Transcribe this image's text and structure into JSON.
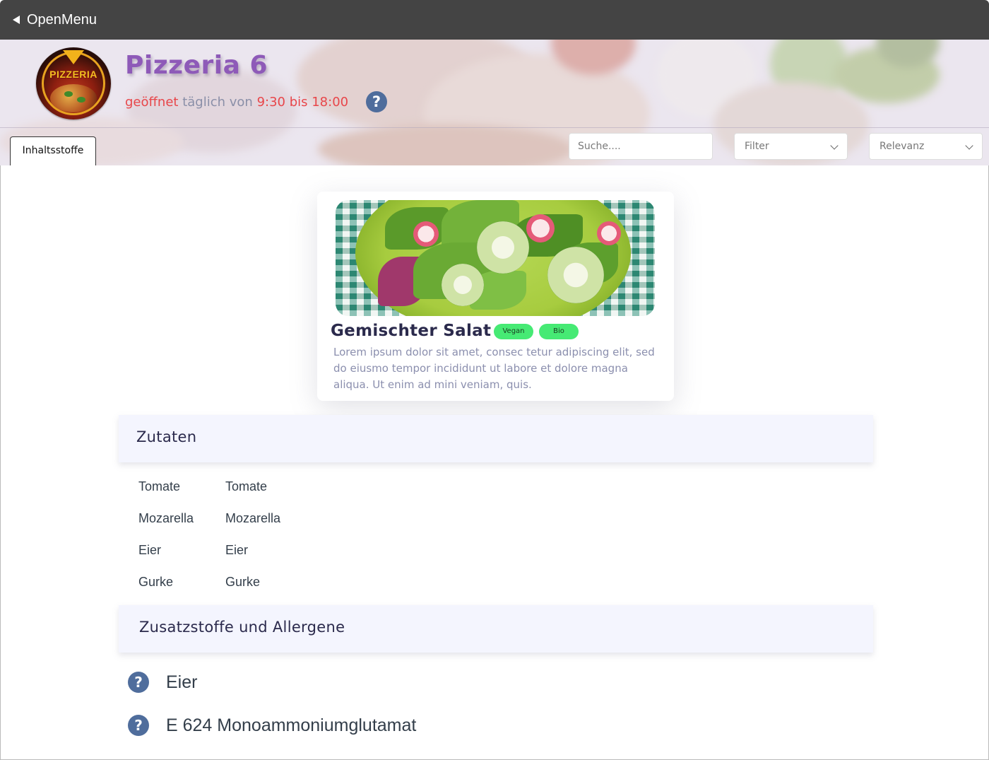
{
  "topbar": {
    "open_menu_label": "OpenMenu"
  },
  "restaurant": {
    "name": "Pizzeria 6",
    "logo_text": "PIZZERIA",
    "hours": {
      "status": "geöffnet",
      "text": "täglich von",
      "time": "9:30 bis 18:00"
    }
  },
  "tabs": [
    {
      "label": "Inhaltsstoffe",
      "active": true
    }
  ],
  "controls": {
    "search_placeholder": "Suche....",
    "filter_value": "Filter",
    "sort_value": "Relevanz"
  },
  "dish": {
    "name": "Gemischter Salat",
    "badges": [
      "Vegan",
      "Bio"
    ],
    "description": "Lorem ipsum dolor sit amet, consec tetur adipiscing elit, sed do eiusmo tempor incididunt ut labore et dolore magna aliqua. Ut enim ad mini veniam, quis."
  },
  "ingredients": {
    "title": "Zutaten",
    "rows": [
      [
        "Tomate",
        "Tomate"
      ],
      [
        "Mozarella",
        "Mozarella"
      ],
      [
        "Eier",
        "Eier"
      ],
      [
        "Gurke",
        "Gurke"
      ]
    ]
  },
  "allergens": {
    "title": "Zusatzstoffe und Allergene",
    "items": [
      "Eier",
      "E 624 Monoammoniumglutamat"
    ]
  },
  "colors": {
    "title": "#8e5ab8",
    "accent_red": "#e8464a",
    "help_icon": "#4f6d9c",
    "badge": "#46ea74",
    "section_bg": "#f4f5fe",
    "topbar": "#444444"
  },
  "icons": {
    "back": "triangle-left-icon",
    "help": "question-circle-icon",
    "dropdown": "chevron-down-icon"
  }
}
